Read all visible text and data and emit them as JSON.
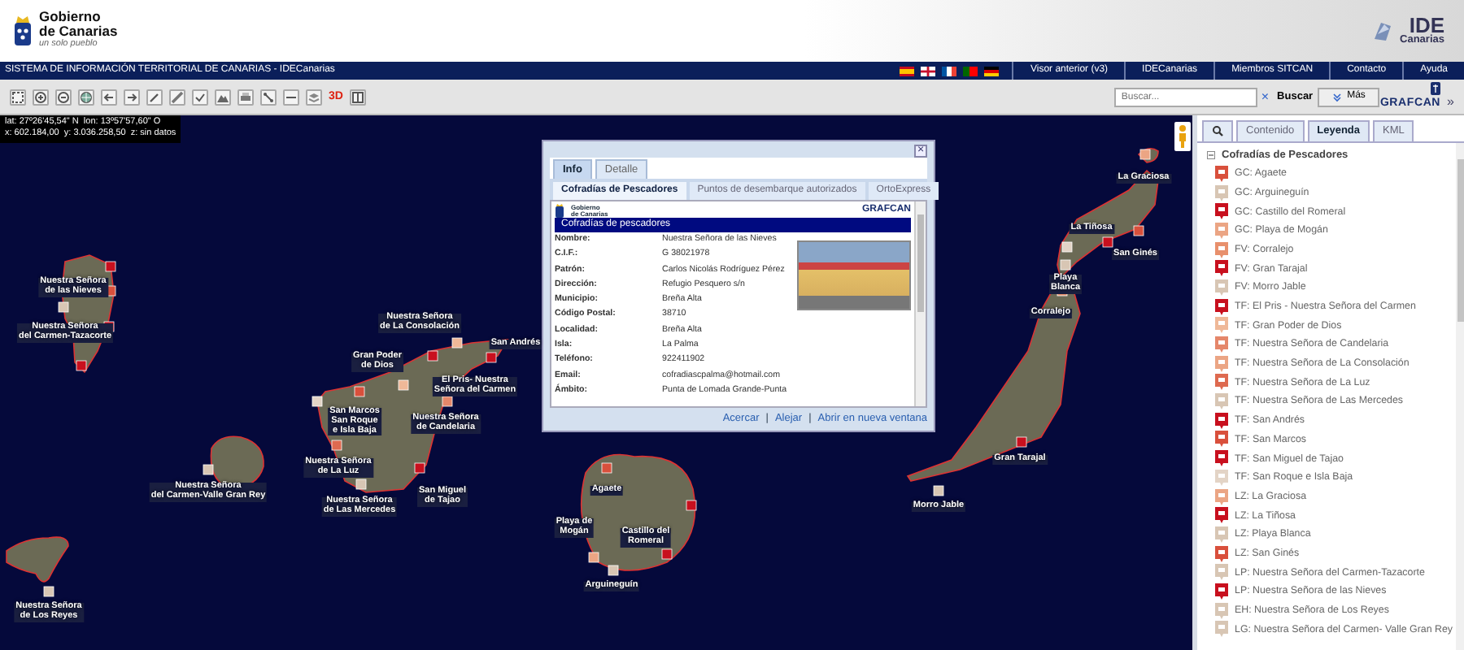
{
  "header": {
    "logo_title": "Gobierno\nde Canarias",
    "logo_motto": "un solo pueblo",
    "ide_logo": "IDE",
    "ide_logo_sub": "Canarias"
  },
  "top_bar": {
    "title": "SISTEMA DE INFORMACIÓN TERRITORIAL DE CANARIAS - IDECanarias",
    "links": [
      "Visor anterior (v3)",
      "IDECanarias",
      "Miembros SITCAN",
      "Contacto",
      "Ayuda"
    ]
  },
  "toolbar": {
    "label_3d": "3D",
    "search": {
      "placeholder": "Buscar..."
    },
    "clear": "×",
    "search_button": "Buscar",
    "more_button": "Más",
    "brand": "GRAFCAN",
    "collapse": "»"
  },
  "coordinates": [
    "lat: 27º26'45,54\" N  lon: 13º57'57,60\" O",
    "x: 602.184,00  y: 3.036.258,50  z: sin datos"
  ],
  "map_labels": [
    "Nuestra Señora\nde las Nieves",
    "Nuestra Señora\ndel Carmen-Tazacorte",
    "Nuestra Señora\ndel Carmen-Valle Gran Rey",
    "Nuestra Señora\nde Los Reyes",
    "Nuestra Señora\nde La Consolación",
    "Gran Poder\nde Dios",
    "San Andrés",
    "El Pris- Nuestra\nSeñora del Carmen",
    "San Marcos\nSan Roque\ne Isla Baja",
    "Nuestra Señora\nde Candelaria",
    "Nuestra Señora\nde La Luz",
    "Nuestra Señora\nde Las Mercedes",
    "San Miguel\nde Tajao",
    "Agaete",
    "Playa de\nMogán",
    "Castillo del\nRomeral",
    "Arguineguín",
    "Morro Jable",
    "Gran Tarajal",
    "Corralejo",
    "Playa\nBlanca",
    "San Ginés",
    "La Tiñosa",
    "La Graciosa"
  ],
  "popup": {
    "close": "×",
    "tabs": [
      {
        "label": "Info",
        "selected": true
      },
      {
        "label": "Detalle",
        "selected": false
      }
    ],
    "subtabs": [
      {
        "label": "Cofradías de Pescadores",
        "selected": true
      },
      {
        "label": "Puntos de desembarque autorizados",
        "selected": false
      },
      {
        "label": "OrtoExpress",
        "selected": false
      }
    ],
    "logo_text": "Gobierno\nde Canarias",
    "brand": "GRAFCAN",
    "section_title": "Cofradías de pescadores",
    "fields": [
      {
        "label": "Nombre:",
        "value": "Nuestra Señora de las Nieves"
      },
      {
        "label": "C.I.F.:",
        "value": "G 38021978"
      },
      {
        "label": "Patrón:",
        "value": "Carlos Nicolás Rodríguez Pérez"
      },
      {
        "label": "Dirección:",
        "value": "Refugio Pesquero s/n"
      },
      {
        "label": "Municipio:",
        "value": "Breña Alta"
      },
      {
        "label": "Código Postal:",
        "value": "38710"
      },
      {
        "label": "Localidad:",
        "value": "Breña Alta"
      },
      {
        "label": "Isla:",
        "value": "La Palma"
      },
      {
        "label": "Teléfono:",
        "value": "922411902"
      },
      {
        "label": "Email:",
        "value": "cofradiascpalma@hotmail.com"
      },
      {
        "label": "Ámbito:",
        "value": "Punta de Lomada Grande-Punta"
      }
    ],
    "links": [
      "Acercar",
      "Alejar",
      "Abrir en nueva ventana"
    ],
    "separator": "|"
  },
  "panel": {
    "tabs": [
      {
        "label": "Contenido",
        "selected": false
      },
      {
        "label": "Leyenda",
        "selected": true
      },
      {
        "label": "KML",
        "selected": false
      }
    ],
    "legend": {
      "title": "Cofradías de Pescadores",
      "expanded": true,
      "items": [
        {
          "label": "GC: Agaete",
          "color": "#d9503c"
        },
        {
          "label": "GC: Arguineguín",
          "color": "#d8c6b4"
        },
        {
          "label": "GC: Castillo del Romeral",
          "color": "#c8101e"
        },
        {
          "label": "GC: Playa de Mogán",
          "color": "#eba584"
        },
        {
          "label": "FV: Corralejo",
          "color": "#e8906c"
        },
        {
          "label": "FV: Gran Tarajal",
          "color": "#c8101e"
        },
        {
          "label": "FV: Morro Jable",
          "color": "#d8c6b4"
        },
        {
          "label": "TF: El Pris - Nuestra Señora del Carmen",
          "color": "#c8101e"
        },
        {
          "label": "TF: Gran Poder de Dios",
          "color": "#efb898"
        },
        {
          "label": "TF: Nuestra Señora de Candelaria",
          "color": "#e5876a"
        },
        {
          "label": "TF: Nuestra Señora de La Consolación",
          "color": "#eba584"
        },
        {
          "label": "TF: Nuestra Señora de La Luz",
          "color": "#de6a50"
        },
        {
          "label": "TF: Nuestra Señora de Las Mercedes",
          "color": "#d8c6b4"
        },
        {
          "label": "TF: San Andrés",
          "color": "#c8101e"
        },
        {
          "label": "TF: San Marcos",
          "color": "#d9503c"
        },
        {
          "label": "TF: San Miguel de Tajao",
          "color": "#c8101e"
        },
        {
          "label": "TF: San Roque e Isla Baja",
          "color": "#e3d4c6"
        },
        {
          "label": "LZ: La Graciosa",
          "color": "#eba584"
        },
        {
          "label": "LZ: La Tiñosa",
          "color": "#c8101e"
        },
        {
          "label": "LZ: Playa Blanca",
          "color": "#d8c6b4"
        },
        {
          "label": "LZ: San Ginés",
          "color": "#d9503c"
        },
        {
          "label": "LP: Nuestra Señora del Carmen-Tazacorte",
          "color": "#d8c6b4"
        },
        {
          "label": "LP: Nuestra Señora de las Nieves",
          "color": "#c8101e"
        },
        {
          "label": "EH: Nuestra Señora de Los Reyes",
          "color": "#d8c6b4"
        },
        {
          "label": "LG: Nuestra Señora del Carmen- Valle Gran Rey",
          "color": "#d8c6b4"
        }
      ]
    }
  }
}
